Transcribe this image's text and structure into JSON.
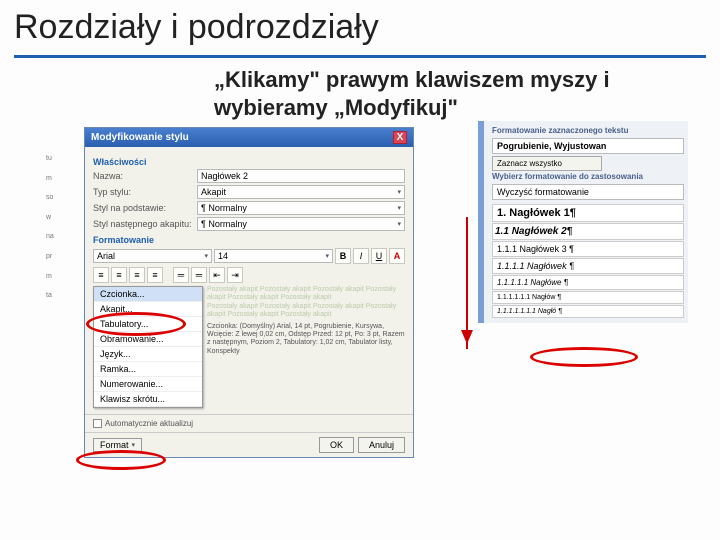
{
  "slide": {
    "title": "Rozdziały i podrozdziały",
    "subtitle": "„Klikamy\" prawym klawiszem myszy i wybieramy „Modyfikuj\""
  },
  "dialog": {
    "title": "Modyfikowanie stylu",
    "section_props": "Właściwości",
    "label_name": "Nazwa:",
    "val_name": "Nagłówek 2",
    "label_type": "Typ stylu:",
    "val_type": "Akapit",
    "label_based": "Styl na podstawie:",
    "val_based": "¶ Normalny",
    "label_next": "Styl następnego akapitu:",
    "val_next": "¶ Normalny",
    "section_format": "Formatowanie",
    "font": "Arial",
    "size": "14",
    "menu": {
      "czcionka": "Czcionka...",
      "akapit": "Akapit...",
      "tabulatory": "Tabulatory...",
      "obramowanie": "Obramowanie...",
      "jezyk": "Język...",
      "ramka": "Ramka...",
      "numerowanie": "Numerowanie...",
      "klawisz": "Klawisz skrótu..."
    },
    "sample": "Pozostały akapit Pozostały akapit Pozostały akapit Pozostały akapit Pozostały akapit Pozostały akapit",
    "desc": "Czcionka: (Domyślny) Arial, 14 pt, Pogrubienie, Kursywa, Wcięcie: Z lewej 0,02 cm, Odstęp Przed: 12 pt, Po: 3 pt, Razem z następnym, Poziom 2, Tabulatory: 1,02 cm, Tabulator listy, Konspekty",
    "auto": "Automatycznie aktualizuj",
    "format_btn": "Format",
    "ok": "OK",
    "cancel": "Anuluj"
  },
  "panel": {
    "hd1": "Formatowanie zaznaczonego tekstu",
    "box1": "Pogrubienie, Wyjustowan",
    "btn_all": "Zaznacz wszystko",
    "hd2": "Wybierz formatowanie do zastosowania",
    "clear": "Wyczyść formatowanie",
    "styles": [
      {
        "num": "1.",
        "name": "Nagłówek 1¶",
        "cls": "lv1"
      },
      {
        "num": "1.1",
        "name": "Nagłówek 2¶",
        "cls": "lv2"
      },
      {
        "num": "1.1.1",
        "name": "Nagłówek 3 ¶",
        "cls": "lv3"
      },
      {
        "num": "1.1.1.1",
        "name": "Nagłówek ¶",
        "cls": "lv4"
      },
      {
        "num": "1.1.1.1.1",
        "name": "Nagłówe ¶",
        "cls": "lv5"
      },
      {
        "num": "1.1.1.1.1.1",
        "name": "Nagłów ¶",
        "cls": "lv6"
      },
      {
        "num": "1.1.1.1.1.1.1",
        "name": "Nagłó ¶",
        "cls": "lv7"
      }
    ]
  },
  "bgtext": [
    "tu",
    "m",
    "so",
    "w",
    "na",
    "pr",
    "m",
    "ta"
  ]
}
